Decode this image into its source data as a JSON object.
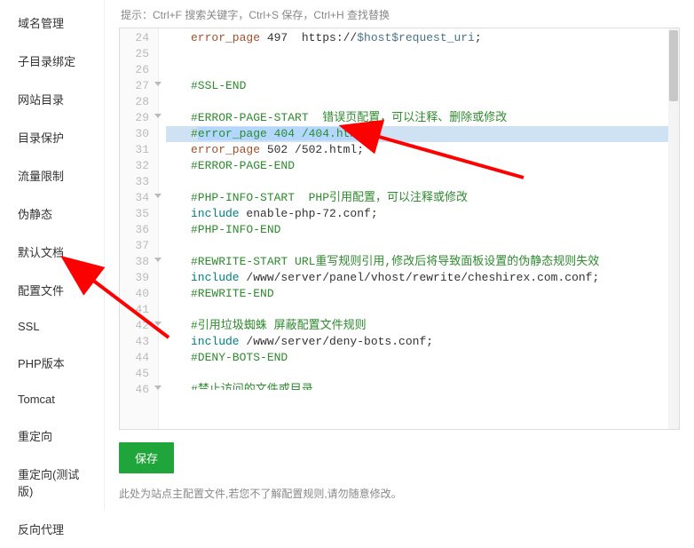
{
  "sidebar": {
    "items": [
      {
        "label": "域名管理"
      },
      {
        "label": "子目录绑定"
      },
      {
        "label": "网站目录"
      },
      {
        "label": "目录保护"
      },
      {
        "label": "流量限制"
      },
      {
        "label": "伪静态"
      },
      {
        "label": "默认文档"
      },
      {
        "label": "配置文件"
      },
      {
        "label": "SSL"
      },
      {
        "label": "PHP版本"
      },
      {
        "label": "Tomcat"
      },
      {
        "label": "重定向"
      },
      {
        "label": "重定向(测试版)"
      },
      {
        "label": "反向代理"
      }
    ],
    "active_index": 7
  },
  "hint": "提示：Ctrl+F 搜索关键字，Ctrl+S 保存，Ctrl+H 查找替换",
  "editor": {
    "first_line": 24,
    "highlighted_line": 30,
    "lines": [
      {
        "n": 24,
        "segs": [
          {
            "t": "error_page",
            "c": "tok-brown"
          },
          {
            "t": " 497  https://",
            "c": ""
          },
          {
            "t": "$host$request_uri",
            "c": "tok-darkcyan"
          },
          {
            "t": ";",
            "c": ""
          }
        ]
      },
      {
        "n": 25,
        "segs": []
      },
      {
        "n": 26,
        "segs": []
      },
      {
        "n": 27,
        "fold": true,
        "segs": [
          {
            "t": "#SSL-END",
            "c": "tok-green"
          }
        ]
      },
      {
        "n": 28,
        "segs": []
      },
      {
        "n": 29,
        "fold": true,
        "segs": [
          {
            "t": "#ERROR-PAGE-START  错误页配置，可以注释、删除或修改",
            "c": "tok-green"
          }
        ]
      },
      {
        "n": 30,
        "hl": true,
        "segs": [
          {
            "t": "#",
            "c": "tok-green"
          },
          {
            "t": "error_page 404 /404.html;",
            "c": "tok-green sel"
          }
        ]
      },
      {
        "n": 31,
        "segs": [
          {
            "t": "error_page",
            "c": "tok-brown"
          },
          {
            "t": " 502 /502.html;",
            "c": ""
          }
        ]
      },
      {
        "n": 32,
        "segs": [
          {
            "t": "#ERROR-PAGE-END",
            "c": "tok-green"
          }
        ]
      },
      {
        "n": 33,
        "segs": []
      },
      {
        "n": 34,
        "fold": true,
        "segs": [
          {
            "t": "#PHP-INFO-START  PHP引用配置，可以注释或修改",
            "c": "tok-green"
          }
        ]
      },
      {
        "n": 35,
        "segs": [
          {
            "t": "include",
            "c": "tok-teal"
          },
          {
            "t": " enable-php-72.conf;",
            "c": ""
          }
        ]
      },
      {
        "n": 36,
        "segs": [
          {
            "t": "#PHP-INFO-END",
            "c": "tok-green"
          }
        ]
      },
      {
        "n": 37,
        "segs": []
      },
      {
        "n": 38,
        "fold": true,
        "segs": [
          {
            "t": "#REWRITE-START URL重写规则引用,修改后将导致面板设置的伪静态规则失效",
            "c": "tok-green"
          }
        ]
      },
      {
        "n": 39,
        "segs": [
          {
            "t": "include",
            "c": "tok-teal"
          },
          {
            "t": " /www/server/panel/vhost/rewrite/cheshirex.com.conf;",
            "c": ""
          }
        ]
      },
      {
        "n": 40,
        "segs": [
          {
            "t": "#REWRITE-END",
            "c": "tok-green"
          }
        ]
      },
      {
        "n": 41,
        "segs": []
      },
      {
        "n": 42,
        "fold": true,
        "segs": [
          {
            "t": "#引用垃圾蜘蛛 屏蔽配置文件规则",
            "c": "tok-green"
          }
        ]
      },
      {
        "n": 43,
        "segs": [
          {
            "t": "include",
            "c": "tok-teal"
          },
          {
            "t": " /www/server/deny-bots.conf;",
            "c": ""
          }
        ]
      },
      {
        "n": 44,
        "segs": [
          {
            "t": "#DENY-BOTS-END",
            "c": "tok-green"
          }
        ]
      },
      {
        "n": 45,
        "segs": []
      },
      {
        "n": 46,
        "fold": true,
        "segs": [
          {
            "t": "#禁止访问的文件或目录",
            "c": "tok-green"
          }
        ],
        "cut": true
      }
    ]
  },
  "save_label": "保存",
  "footnote": "此处为站点主配置文件,若您不了解配置规则,请勿随意修改。"
}
